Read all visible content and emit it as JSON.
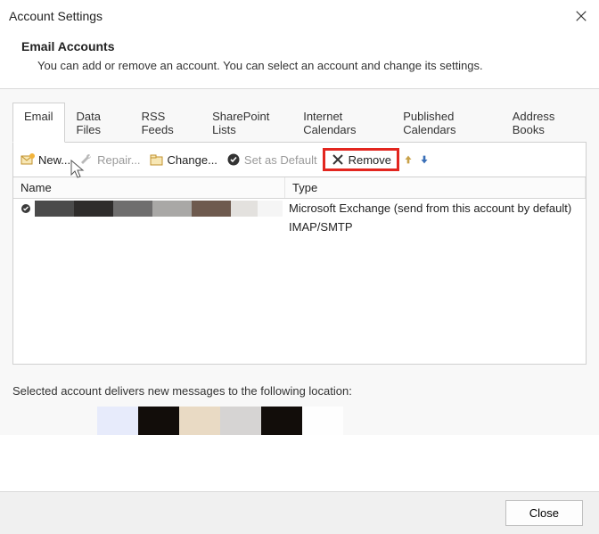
{
  "window": {
    "title": "Account Settings"
  },
  "header": {
    "heading": "Email Accounts",
    "description": "You can add or remove an account. You can select an account and change its settings."
  },
  "tabs": [
    {
      "label": "Email",
      "active": true
    },
    {
      "label": "Data Files",
      "active": false
    },
    {
      "label": "RSS Feeds",
      "active": false
    },
    {
      "label": "SharePoint Lists",
      "active": false
    },
    {
      "label": "Internet Calendars",
      "active": false
    },
    {
      "label": "Published Calendars",
      "active": false
    },
    {
      "label": "Address Books",
      "active": false
    }
  ],
  "toolbar": {
    "new_label": "New...",
    "repair_label": "Repair...",
    "change_label": "Change...",
    "default_label": "Set as Default",
    "remove_label": "Remove"
  },
  "list": {
    "columns": {
      "name": "Name",
      "type": "Type"
    },
    "rows": [
      {
        "name_redacted": true,
        "type": "Microsoft Exchange (send from this account by default)",
        "is_default": true
      },
      {
        "name_redacted": true,
        "type": "IMAP/SMTP",
        "is_default": false
      }
    ]
  },
  "delivers_text": "Selected account delivers new messages to the following location:",
  "footer": {
    "close_label": "Close"
  },
  "highlighted_button": "remove",
  "redaction_colors_row1": [
    "#4b4b4b",
    "#2e2c2b",
    "#6f6e6e",
    "#a9a8a6",
    "#6e5a4e",
    "#e3e1de",
    "#f5f5f5"
  ],
  "redaction_widths_row1": [
    44,
    44,
    44,
    44,
    44,
    30,
    28
  ],
  "redaction_colors_loc": [
    "#e7ebfb",
    "#120d0a",
    "#e9dac4",
    "#d6d4d3",
    "#120d0a",
    "#fefefe"
  ],
  "redaction_widths_loc": [
    46,
    46,
    46,
    46,
    46,
    46
  ]
}
